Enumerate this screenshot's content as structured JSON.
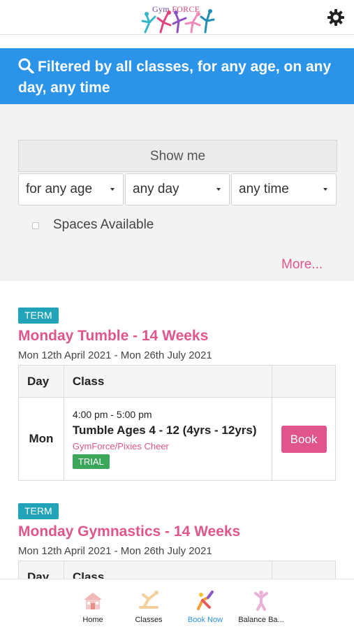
{
  "header": {
    "logo_text_a": "Gym ",
    "logo_text_b": "FORCE",
    "settings_icon": "gear-icon"
  },
  "filter_banner": {
    "icon": "search-icon",
    "text": "Filtered by all classes, for any age, on any day, any time",
    "color": "#2b94e9"
  },
  "filters": {
    "show_me_label": "Show me",
    "age": "for any age",
    "day": "any day",
    "time": "any time",
    "spaces_available_label": "Spaces Available",
    "spaces_available_checked": false,
    "more_label": "More..."
  },
  "classes": [
    {
      "badge": "TERM",
      "title": "Monday Tumble - 14 Weeks",
      "dates": "Mon 12th April 2021 - Mon 26th July 2021",
      "table": {
        "headers": [
          "Day",
          "Class",
          ""
        ],
        "rows": [
          {
            "day": "Mon",
            "time": "4:00 pm - 5:00 pm",
            "name": "Tumble Ages 4 - 12 (4yrs - 12yrs)",
            "venue": "GymForce/Pixies Cheer",
            "tag": "TRIAL",
            "action": "Book"
          }
        ]
      }
    },
    {
      "badge": "TERM",
      "title": "Monday Gymnastics - 14 Weeks",
      "dates": "Mon 12th April 2021 - Mon 26th July 2021",
      "table": {
        "headers": [
          "Day",
          "Class",
          ""
        ]
      }
    }
  ],
  "bottom_nav": [
    {
      "label": "Home",
      "icon": "home-icon",
      "active": false
    },
    {
      "label": "Classes",
      "icon": "classes-icon",
      "active": false
    },
    {
      "label": "Book Now",
      "icon": "book-now-icon",
      "active": true
    },
    {
      "label": "Balance Ba...",
      "icon": "balance-icon",
      "active": false
    }
  ],
  "colors": {
    "accent_pink": "#e0568c",
    "term_badge": "#21a3b8",
    "trial_badge": "#3ca75a",
    "active_nav": "#2b94e9"
  }
}
